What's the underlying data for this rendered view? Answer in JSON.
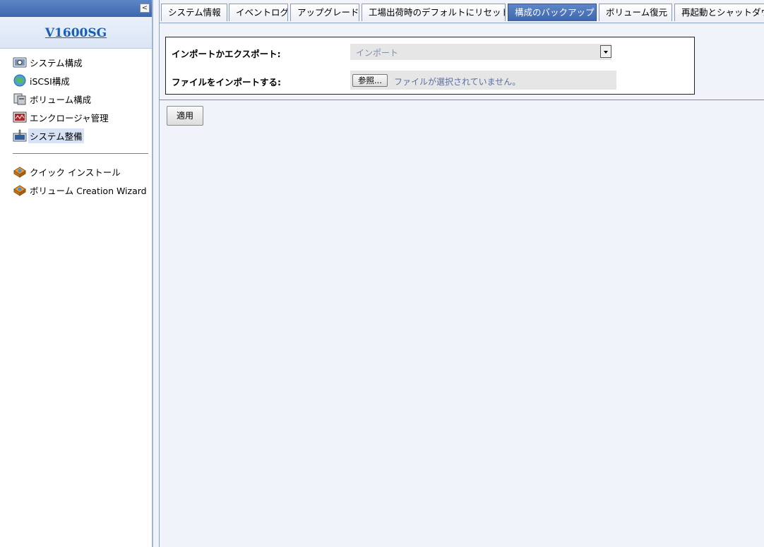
{
  "sidebar": {
    "collapse_glyph": "<",
    "brand": "V1600SG",
    "nav": [
      {
        "label": "システム構成",
        "icon": "system-config-icon",
        "selected": false
      },
      {
        "label": "iSCSI構成",
        "icon": "iscsi-globe-icon",
        "selected": false
      },
      {
        "label": "ボリューム構成",
        "icon": "volume-config-icon",
        "selected": false
      },
      {
        "label": "エンクロージャ管理",
        "icon": "enclosure-monitor-icon",
        "selected": false
      },
      {
        "label": "システム整備",
        "icon": "maintenance-tools-icon",
        "selected": true
      }
    ],
    "wizards": [
      {
        "label": "クイック インストール",
        "icon": "quick-install-icon"
      },
      {
        "label": "ボリューム  Creation Wizard",
        "icon": "volume-wizard-icon"
      }
    ]
  },
  "tabs": [
    {
      "label": "システム情報",
      "active": false
    },
    {
      "label": "イベントログ",
      "active": false
    },
    {
      "label": "アップグレード",
      "active": false
    },
    {
      "label": "工場出荷時のデフォルトにリセット",
      "active": false
    },
    {
      "label": "構成のバックアップ",
      "active": true
    },
    {
      "label": "ボリューム復元",
      "active": false
    },
    {
      "label": "再起動とシャットダウン",
      "active": false
    }
  ],
  "form": {
    "import_export_label": "インポートかエクスポート:",
    "import_export_value": "インポート",
    "file_label": "ファイルをインポートする:",
    "browse_button": "参照...",
    "file_status": "ファイルが選択されていません。"
  },
  "apply_button": "適用",
  "colors": {
    "accent": "#3c66ad",
    "background": "#f0f4fa",
    "brand_link": "#1a5fb4"
  }
}
